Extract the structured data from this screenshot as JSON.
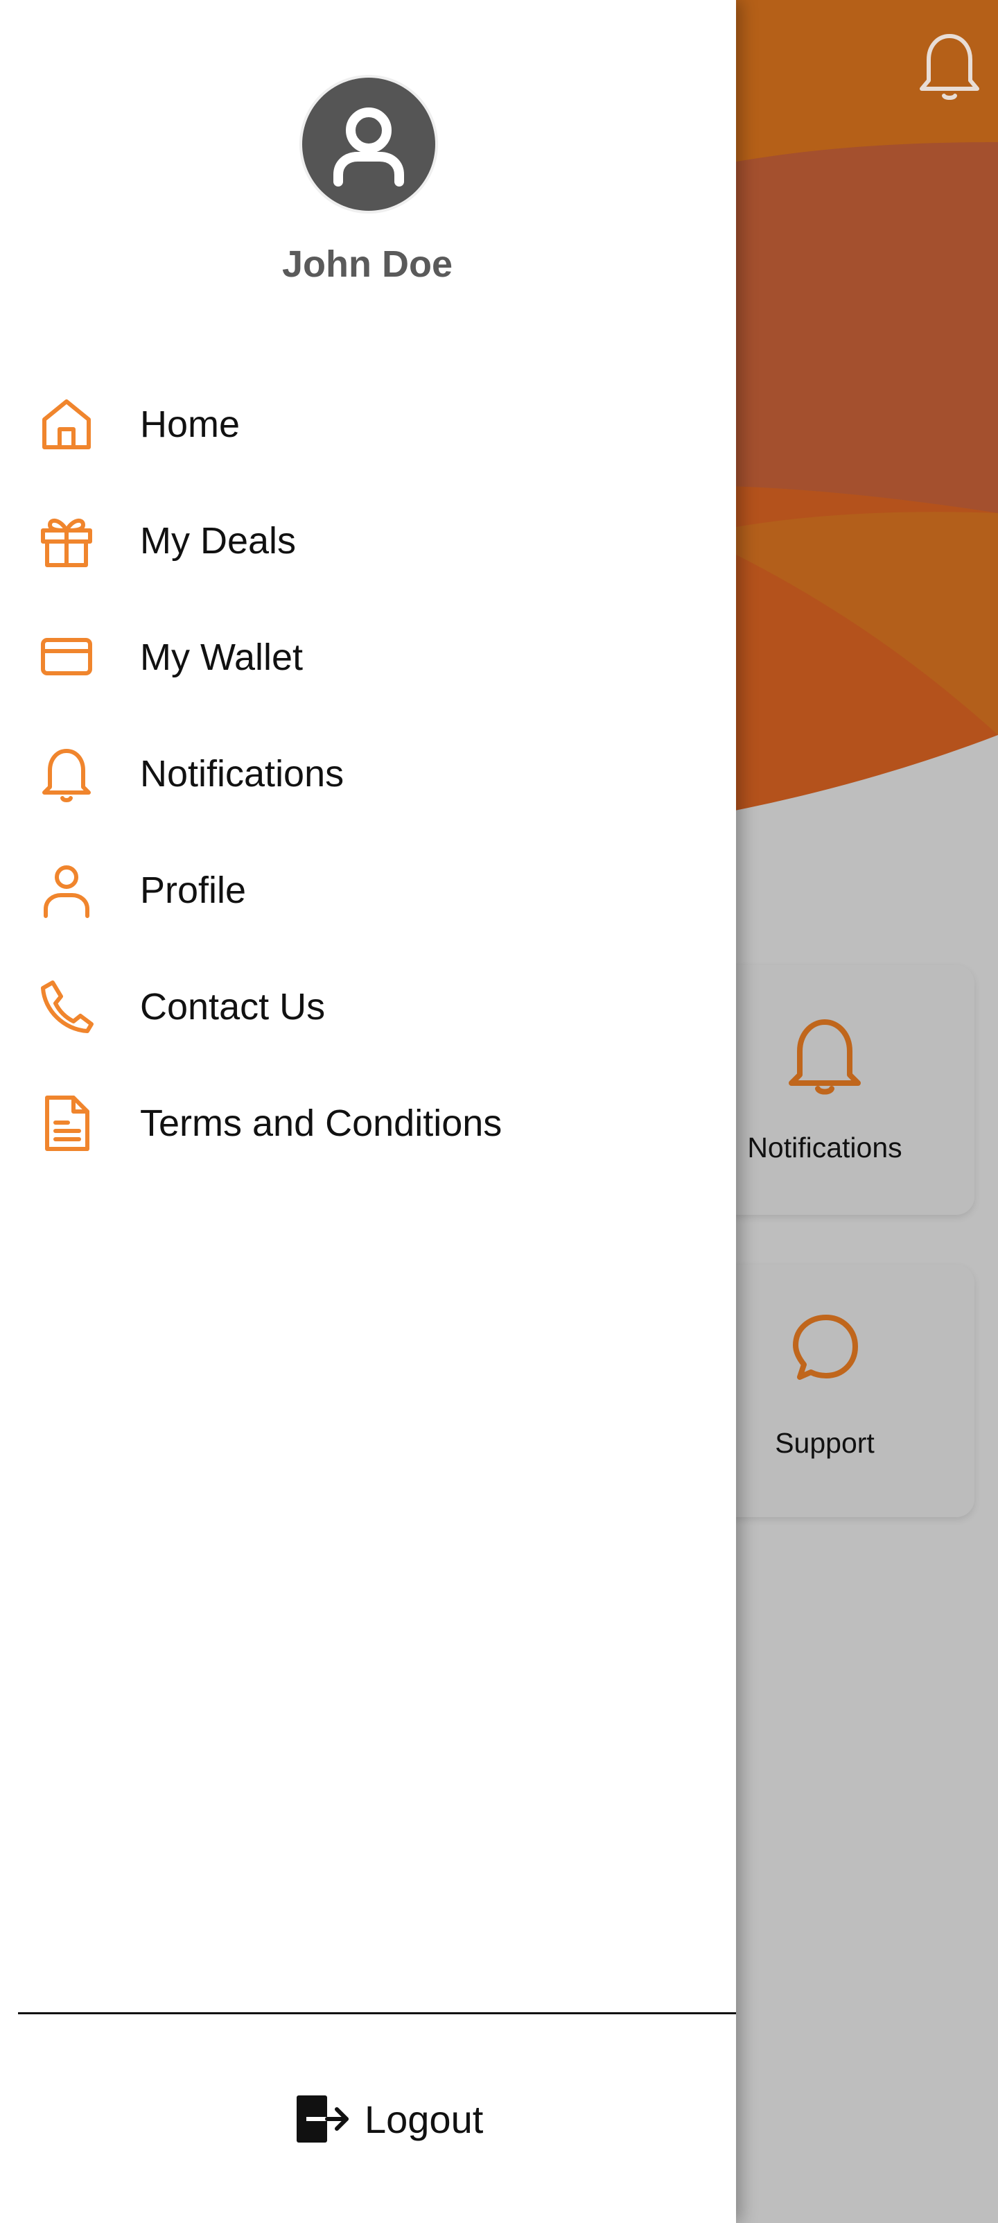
{
  "colors": {
    "accent": "#F0852D",
    "hero_orange": "#B56018",
    "hero_dark": "#A9512E",
    "avatar_bg": "#555555",
    "scrim_gray": "#BDBDBD"
  },
  "drawer": {
    "user_name": "John Doe",
    "avatar_icon": "user-circle-icon",
    "menu": [
      {
        "label": "Home",
        "icon": "home-icon"
      },
      {
        "label": "My Deals",
        "icon": "gift-icon"
      },
      {
        "label": "My Wallet",
        "icon": "credit-card-icon"
      },
      {
        "label": "Notifications",
        "icon": "bell-icon"
      },
      {
        "label": "Profile",
        "icon": "user-icon"
      },
      {
        "label": "Contact Us",
        "icon": "phone-icon"
      },
      {
        "label": "Terms and Conditions",
        "icon": "document-icon"
      }
    ],
    "logout_label": "Logout",
    "logout_icon": "logout-icon"
  },
  "background": {
    "header_icon": "bell-icon",
    "cards": [
      {
        "label": "Notifications",
        "icon": "bell-icon"
      },
      {
        "label": "Support",
        "icon": "chat-bubble-icon"
      }
    ]
  }
}
